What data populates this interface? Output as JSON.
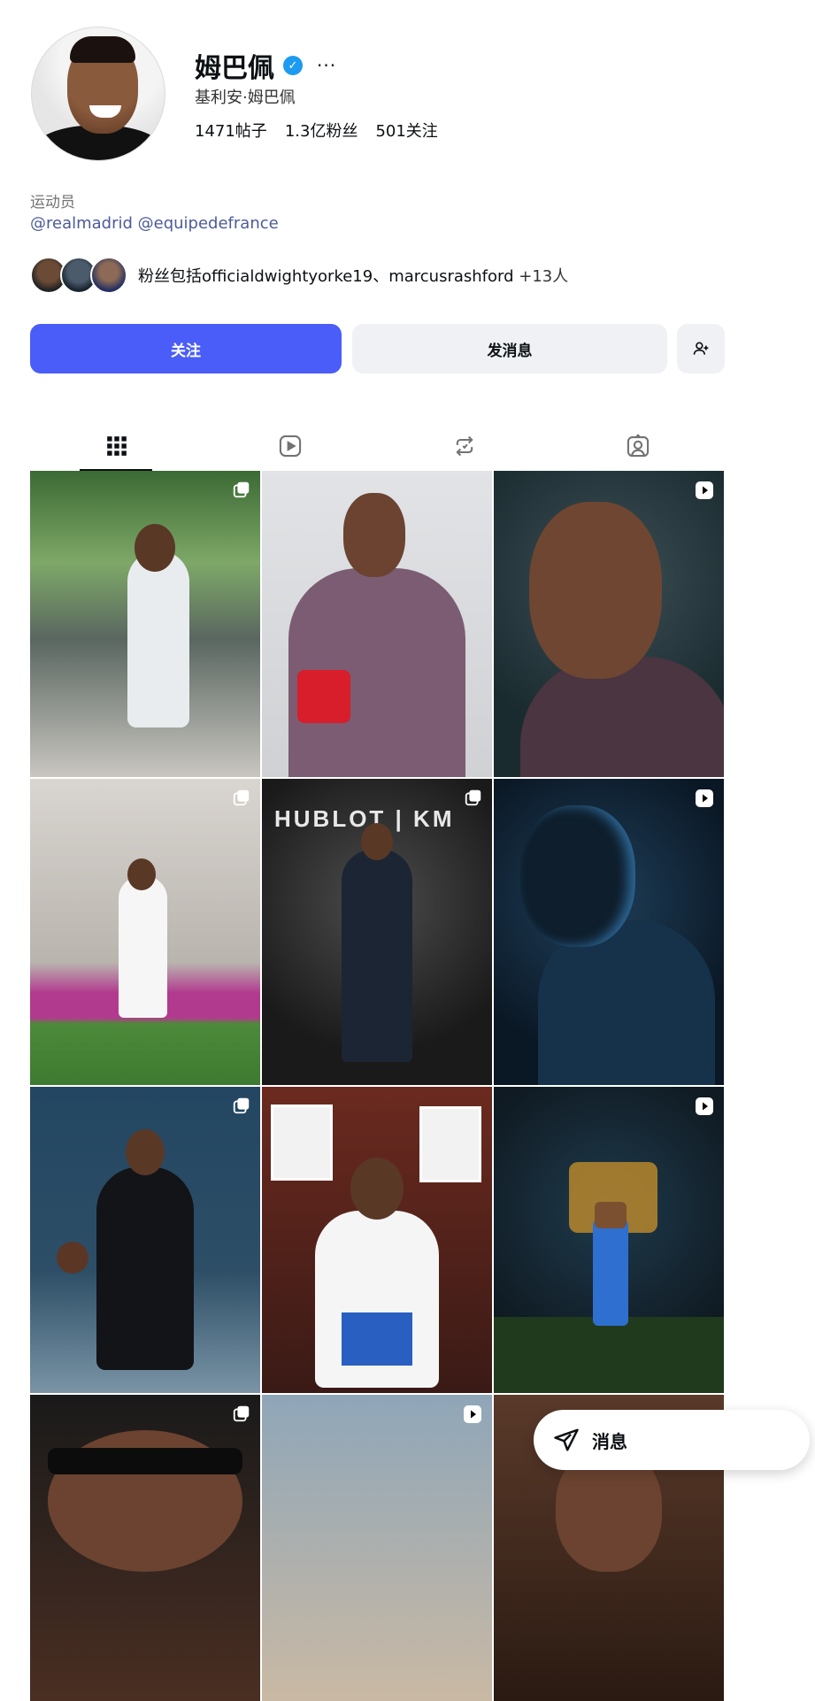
{
  "profile": {
    "name": "姆巴佩",
    "verified_mark": "✓",
    "more": "···",
    "full_name": "基利安·姆巴佩",
    "stats": {
      "posts": "1471帖子",
      "followers": "1.3亿粉丝",
      "following": "501关注"
    },
    "category": "运动员",
    "links": "@realmadrid @equipedefrance",
    "followed_by_prefix": "粉丝包括officialdwightyorke19、marcusrashford",
    "followed_by_more": " +13人"
  },
  "actions": {
    "follow_label": "关注",
    "message_label": "发消息",
    "add_icon": "add-user-icon"
  },
  "tabs": [
    {
      "name": "posts-grid-icon",
      "active": true
    },
    {
      "name": "reels-icon",
      "active": false
    },
    {
      "name": "reposts-icon",
      "active": false
    },
    {
      "name": "tagged-icon",
      "active": false
    }
  ],
  "grid_text": {
    "hublot_label": "HUBLOT | KM"
  },
  "floating": {
    "messages_label": "消息"
  },
  "colors": {
    "accent": "#4a5df9",
    "verified": "#1d9bf0",
    "link": "#4c5a9b"
  }
}
